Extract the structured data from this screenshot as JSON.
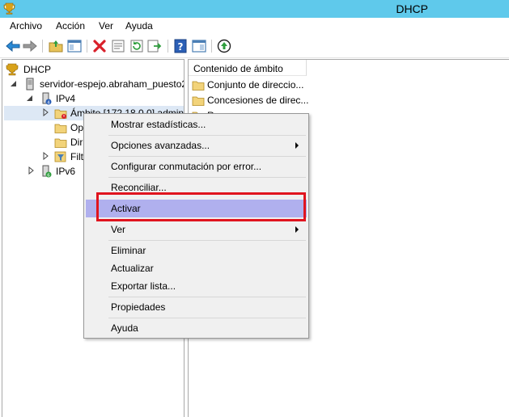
{
  "window": {
    "title": "DHCP",
    "app_icon": "dhcp-trophy-icon"
  },
  "menubar": {
    "items": [
      "Archivo",
      "Acción",
      "Ver",
      "Ayuda"
    ]
  },
  "toolbar": {
    "buttons": [
      "back-arrow-icon",
      "forward-arrow-icon",
      "up-folder-icon",
      "show-hide-console-tree-icon",
      "delete-icon",
      "properties-icon",
      "refresh-icon",
      "export-list-icon",
      "help-icon",
      "show-action-pane-icon",
      "activate-icon"
    ]
  },
  "tree": {
    "root": "DHCP",
    "server": "servidor-espejo.abraham_puesto2",
    "ipv4": "IPv4",
    "scope": "Ámbito [172.18.0.0] admin",
    "opt": "Op",
    "dir": "Dir",
    "filt": "Filt",
    "ipv6": "IPv6"
  },
  "content": {
    "column_header": "Contenido de ámbito",
    "items": [
      "Conjunto de direccio...",
      "Concesiones de direc...",
      "R"
    ]
  },
  "context_menu": {
    "items": [
      {
        "label": "Mostrar estadísticas...",
        "submenu": false
      },
      {
        "label": "Opciones avanzadas...",
        "submenu": true
      },
      {
        "label": "Configurar conmutación por error...",
        "submenu": false
      },
      {
        "label": "Reconciliar...",
        "submenu": false
      },
      {
        "label": "Activar",
        "submenu": false,
        "highlighted": true
      },
      {
        "label": "Ver",
        "submenu": true
      },
      {
        "label": "Eliminar",
        "submenu": false
      },
      {
        "label": "Actualizar",
        "submenu": false
      },
      {
        "label": "Exportar lista...",
        "submenu": false
      },
      {
        "label": "Propiedades",
        "submenu": false
      },
      {
        "label": "Ayuda",
        "submenu": false
      }
    ]
  },
  "colors": {
    "titlebar": "#5fc9eb",
    "highlight": "#b0b0ee",
    "annotation_box": "#e0141e"
  }
}
